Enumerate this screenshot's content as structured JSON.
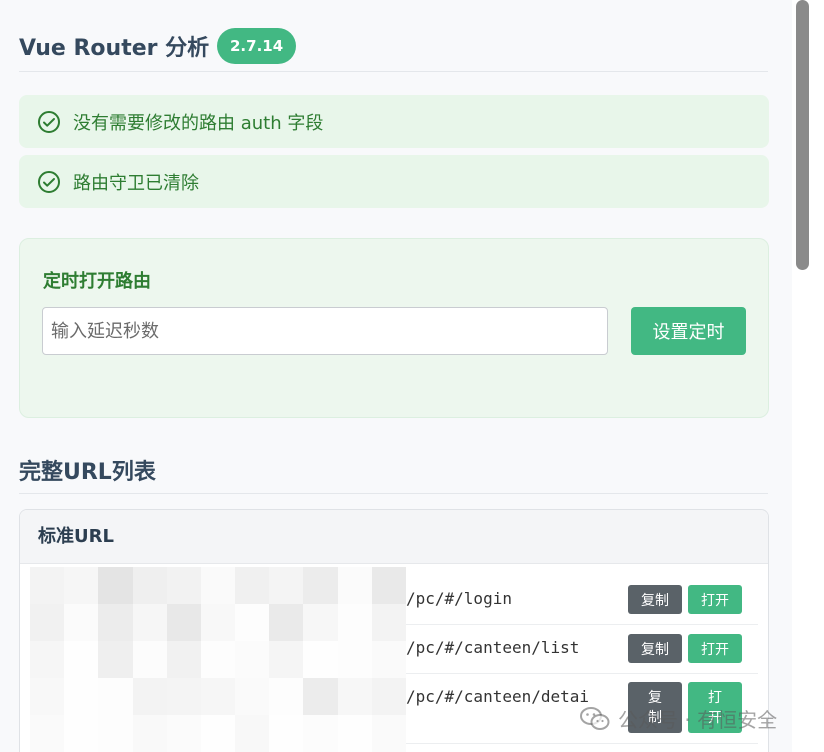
{
  "header": {
    "title": "Vue Router 分析",
    "version": "2.7.14"
  },
  "alerts": [
    {
      "icon": "check-circle-icon",
      "text": "没有需要修改的路由 auth 字段"
    },
    {
      "icon": "check-circle-icon",
      "text": "路由守卫已清除"
    }
  ],
  "timer": {
    "title": "定时打开路由",
    "input_placeholder": "输入延迟秒数",
    "button_label": "设置定时"
  },
  "url_section": {
    "title": "完整URL列表",
    "card_title": "标准URL",
    "rows": [
      {
        "url": "/pc/#/login",
        "copy_label": "复制",
        "open_label": "打开"
      },
      {
        "url": "/pc/#/canteen/list",
        "copy_label": "复制",
        "open_label": "打开"
      },
      {
        "url": "/pc/#/canteen/detai",
        "copy_label": "复\n制",
        "open_label": "打\n开"
      }
    ]
  },
  "watermark": {
    "text": "公众号 · 有恒安全",
    "icon": "wechat-icon"
  },
  "colors": {
    "accent": "#42b883",
    "success_text": "#2e7d32",
    "success_bg": "#e8f6ea",
    "copy_btn": "#5a6268"
  }
}
